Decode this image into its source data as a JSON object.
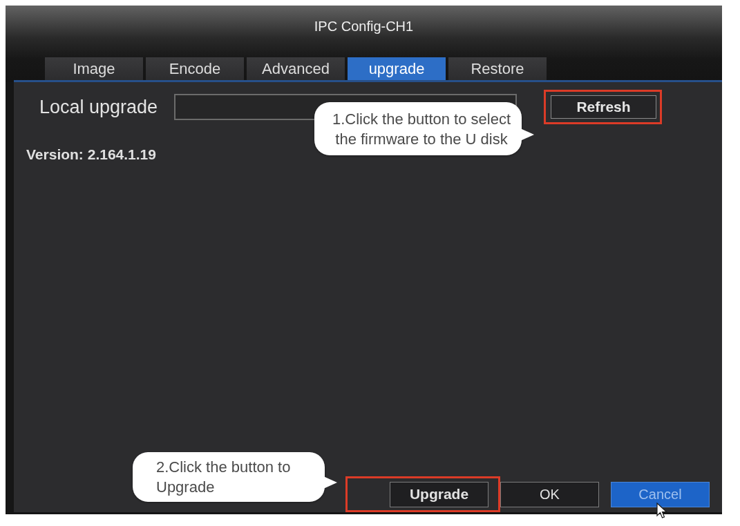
{
  "window": {
    "title": "IPC Config-CH1"
  },
  "tabs": [
    {
      "label": "Image",
      "selected": false
    },
    {
      "label": "Encode",
      "selected": false
    },
    {
      "label": "Advanced",
      "selected": false
    },
    {
      "label": "upgrade",
      "selected": true
    },
    {
      "label": "Restore",
      "selected": false
    }
  ],
  "local_upgrade": {
    "label": "Local upgrade"
  },
  "refresh_button": {
    "label": "Refresh",
    "highlighted": true
  },
  "version": "Version: 2.164.1.19",
  "buttons": [
    {
      "label": "Upgrade",
      "selected": false,
      "highlighted": true
    },
    {
      "label": "OK",
      "selected": false,
      "highlighted": false
    },
    {
      "label": "Cancel",
      "selected": true,
      "highlighted": false
    }
  ],
  "callouts": [
    {
      "text": "1.Click the button to select\nthe firmware to the U disk"
    },
    {
      "text": "2.Click the button to\nUpgrade"
    }
  ]
}
